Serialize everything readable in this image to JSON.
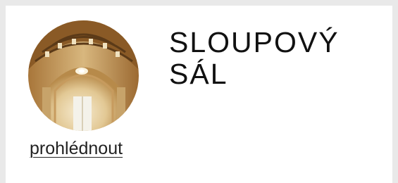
{
  "card": {
    "title_line1": "SLOUPOVÝ",
    "title_line2": "SÁL",
    "link_label": "prohlédnout",
    "image_alt": "Sloupový sál – klenutý strop"
  },
  "colors": {
    "page_background": "#e9e9e9",
    "card_background": "#ffffff",
    "title_text": "#111111",
    "link_text": "#222222"
  }
}
